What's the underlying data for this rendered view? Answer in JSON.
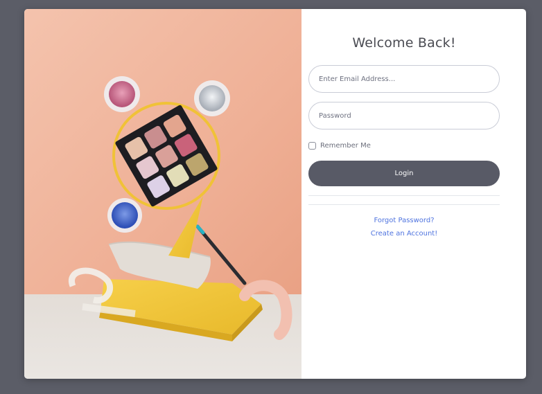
{
  "login": {
    "title": "Welcome Back!",
    "email_placeholder": "Enter Email Address...",
    "password_placeholder": "Password",
    "remember_label": "Remember Me",
    "login_label": "Login",
    "forgot_label": "Forgot Password?",
    "create_label": "Create an Account!"
  },
  "colors": {
    "page_background": "#5b5d67",
    "card_background": "#ffffff",
    "button_background": "#585a66",
    "link": "#4e73df",
    "hero_wall": "#f0b49c",
    "hero_floor": "#e6e0da",
    "hero_yellow": "#f2c53a"
  },
  "hero_image": {
    "subject": "makeup still life with eyeshadow palette on yellow pedestal"
  }
}
